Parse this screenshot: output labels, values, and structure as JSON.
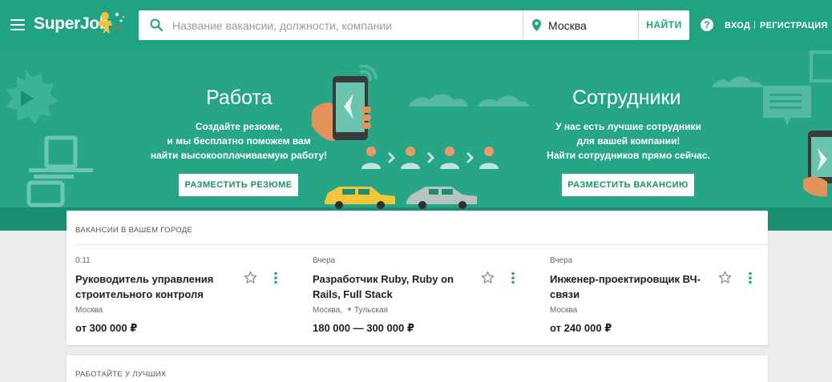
{
  "header": {
    "logo_text": "SuperJob",
    "search_placeholder": "Название вакансии, должности, компании",
    "location": "Москва",
    "find_label": "НАЙТИ",
    "help_glyph": "?",
    "login_label": "ВХОД",
    "separator": "|",
    "register_label": "РЕГИСТРАЦИЯ"
  },
  "hero": {
    "left": {
      "title": "Работа",
      "text_lines": [
        "Создайте резюме,",
        "и мы бесплатно поможем вам",
        "найти высокооплачиваемую работу!"
      ],
      "button_label": "РАЗМЕСТИТЬ РЕЗЮМЕ"
    },
    "right": {
      "title": "Сотрудники",
      "text_lines": [
        "У нас есть лучшие сотрудники",
        "для вашей компании!",
        "Найти сотрудников прямо сейчас."
      ],
      "button_label": "РАЗМЕСТИТЬ ВАКАНСИЮ"
    }
  },
  "vacancies": {
    "section_title": "ВАКАНСИИ В ВАШЕМ ГОРОДЕ",
    "items": [
      {
        "time": "0:11",
        "title": "Руководитель управления строительного контроля",
        "city": "Москва,",
        "city_extra": "",
        "salary": "от 300 000 ₽"
      },
      {
        "time": "Вчера",
        "title": "Разработчик Ruby, Ruby on Rails, Full Stack",
        "city": "Москва,",
        "city_extra": "Тульская",
        "salary": "180 000 — 300 000 ₽"
      },
      {
        "time": "Вчера",
        "title": "Инженер-проектировщик ВЧ-связи",
        "city": "Москва",
        "city_extra": "",
        "salary": "от 240 000 ₽"
      }
    ]
  },
  "best": {
    "section_title": "РАБОТАЙТЕ У ЛУЧШИХ"
  },
  "colors": {
    "brand": "#1fa383",
    "hero_bg": "#26a687",
    "hero_dark": "#1b8f74",
    "page_bg": "#ececec"
  }
}
